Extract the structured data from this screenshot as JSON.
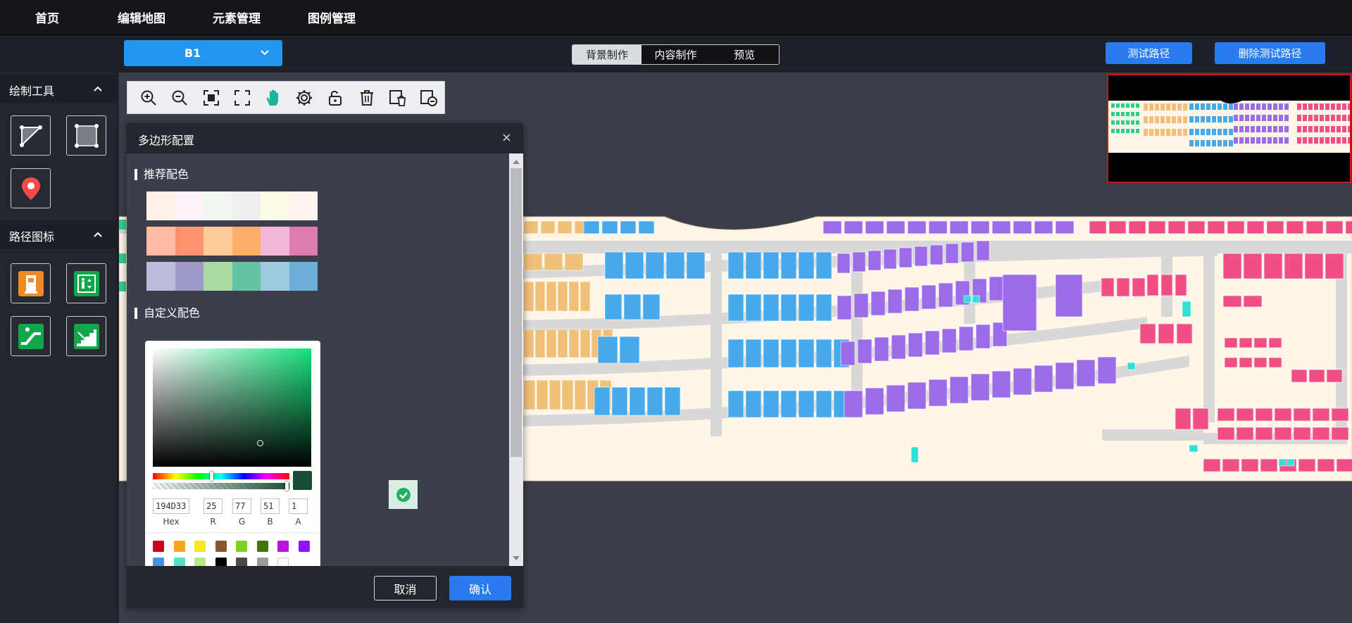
{
  "nav": {
    "items": [
      {
        "label": "首页"
      },
      {
        "label": "编辑地图"
      },
      {
        "label": "元素管理"
      },
      {
        "label": "图例管理"
      }
    ]
  },
  "floor_select": {
    "value": "B1"
  },
  "mode_tabs": [
    {
      "label": "背景制作",
      "active": true
    },
    {
      "label": "内容制作",
      "active": false
    },
    {
      "label": "预览",
      "active": false
    }
  ],
  "actions": {
    "test_path": "测试路径",
    "delete_test_path": "删除测试路径"
  },
  "sidebar": {
    "draw_tools_title": "绘制工具",
    "draw_tools": [
      "polyline-tool-icon",
      "rectangle-tool-icon",
      "location-pin-icon"
    ],
    "path_icons_title": "路径图标",
    "path_icons": [
      "elevator-icon",
      "lift-icon",
      "escalator-icon",
      "stairs-icon"
    ]
  },
  "map_tools": [
    "zoom-in-icon",
    "zoom-out-icon",
    "fit-screen-icon",
    "fullscreen-icon",
    "pan-hand-icon",
    "settings-icon",
    "unlock-icon",
    "delete-icon",
    "delete-layer-icon",
    "remove-layer-icon"
  ],
  "dialog": {
    "title": "多边形配置",
    "close": "×",
    "recommended_title": "推荐配色",
    "recommended_palettes": [
      [
        "#fff1ea",
        "#fdf3fa",
        "#f0f8ef",
        "#efefef",
        "#fdfde6",
        "#fff3ee"
      ],
      [
        "#fdbba3",
        "#fd9270",
        "#fdcc9a",
        "#fdae6b",
        "#f2b8d8",
        "#de7bb1"
      ],
      [
        "#bcbddc",
        "#9e9ac8",
        "#a9dca3",
        "#66c2a4",
        "#9ecae1",
        "#6baed6"
      ]
    ],
    "custom_title": "自定义配色",
    "picker": {
      "hex": "194D33",
      "r": "25",
      "g": "77",
      "b": "51",
      "a": "1",
      "labels": {
        "hex": "Hex",
        "r": "R",
        "g": "G",
        "b": "B",
        "a": "A"
      },
      "presets": [
        "#d0021b",
        "#f5a623",
        "#f8e71c",
        "#8b572a",
        "#7ed321",
        "#417505",
        "#bd10e0",
        "#9013fe",
        "#4a90e2",
        "#50e3c2",
        "#b8e986",
        "#000000",
        "#4a4a4a",
        "#9b9b9b",
        "#ffffff"
      ]
    },
    "cancel": "取消",
    "confirm": "确认"
  },
  "colors": {
    "accent": "#2a7bf0",
    "floor_select": "#2196f3",
    "map_bg": "#fff6e8",
    "road": "#d8d8d8",
    "orange_block": "#f0c079",
    "blue_block": "#45a9ec",
    "purple_block": "#9b6bea",
    "pink_block": "#ef4f86",
    "cyan_block": "#2fe0d6",
    "green_block": "#2ecf8e"
  }
}
